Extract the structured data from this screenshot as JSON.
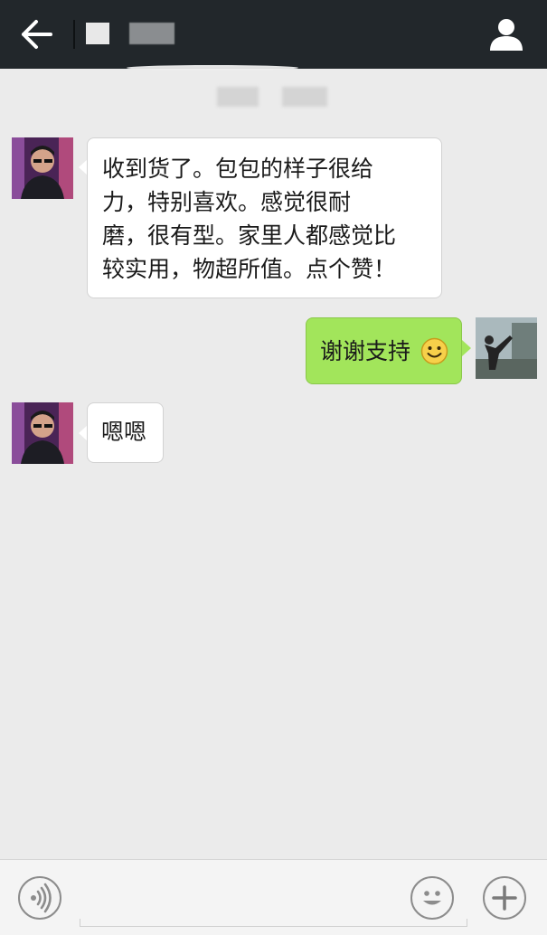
{
  "colors": {
    "topbar": "#22272b",
    "background": "#ebebeb",
    "incoming_bubble": "#ffffff",
    "outgoing_bubble": "#a2e55b",
    "icon_gray": "#8c8c8c"
  },
  "header": {
    "back_icon": "arrow-left-icon",
    "profile_icon": "person-icon"
  },
  "messages": [
    {
      "sender": "contact",
      "lines": [
        "收到货了。包包的样子很给",
        "力，特别喜欢。感觉很耐",
        "磨，很有型。家里人都感觉比",
        "较实用，物超所值。点个赞！"
      ]
    },
    {
      "sender": "me",
      "text": "谢谢支持",
      "emoji": "smiley-emoji"
    },
    {
      "sender": "contact",
      "text": "嗯嗯"
    }
  ],
  "input_bar": {
    "voice_icon": "voice-icon",
    "emoji_icon": "emoji-face-icon",
    "add_icon": "plus-icon",
    "message_value": "",
    "placeholder": ""
  }
}
